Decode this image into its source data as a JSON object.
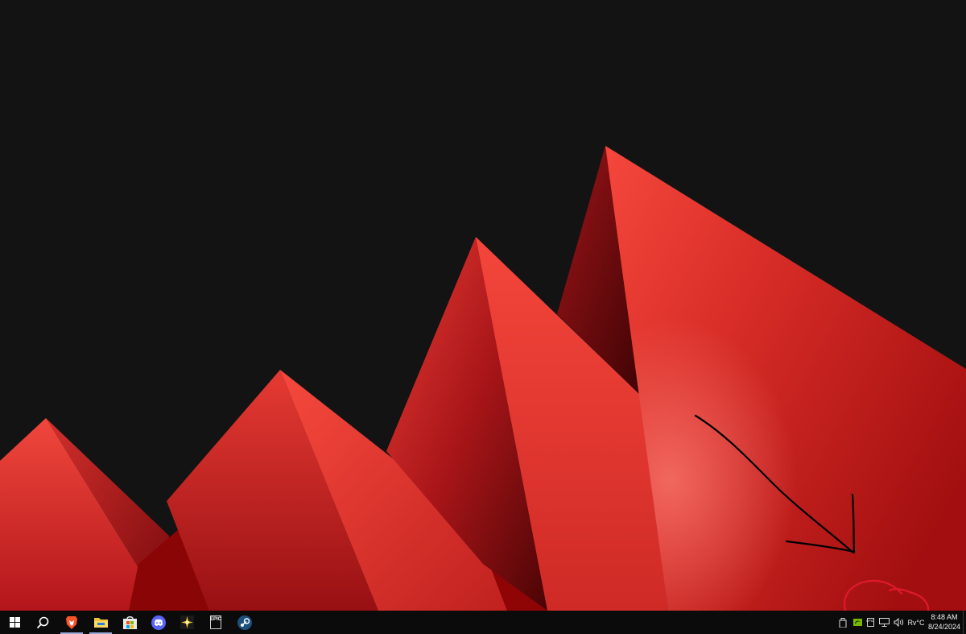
{
  "desktop": {
    "wallpaper": "red-geometric-peaks",
    "background_color": "#131313",
    "annotation": {
      "shape": "hand-drawn-arrow-and-circle",
      "arrow_color": "#000000",
      "circle_color": "#e0192c"
    }
  },
  "taskbar": {
    "background": "#0b0b0b",
    "start_icon": "windows-logo-icon",
    "search_icon": "search-icon",
    "pinned_apps": [
      {
        "name": "brave-browser-icon",
        "active": true
      },
      {
        "name": "file-explorer-icon",
        "active": true
      },
      {
        "name": "microsoft-store-icon",
        "active": false
      },
      {
        "name": "discord-icon",
        "active": false
      },
      {
        "name": "sparkle-app-icon",
        "active": false
      },
      {
        "name": "epic-games-icon",
        "active": false,
        "label": "EPIC"
      },
      {
        "name": "steam-icon",
        "active": false
      }
    ],
    "tray": {
      "icons": [
        "usb-device-icon",
        "nvidia-icon",
        "epic-games-tray-icon",
        "network-icon",
        "volume-icon"
      ],
      "epic_label": "EPIC",
      "input_label": "Rv°C",
      "time": "8:48 AM",
      "date": "8/24/2024"
    }
  }
}
